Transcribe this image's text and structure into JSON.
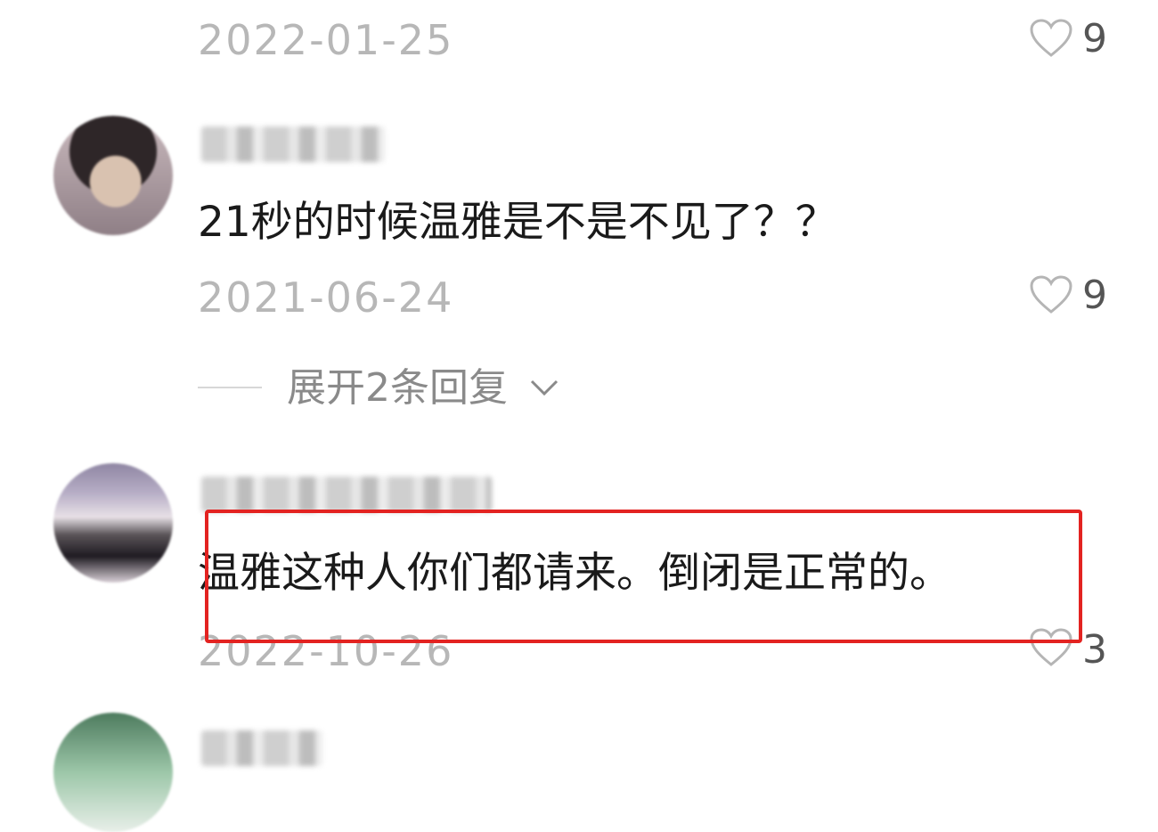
{
  "comments": [
    {
      "date": "2022-01-25",
      "likes": "9"
    },
    {
      "text": "21秒的时候温雅是不是不见了？？",
      "date": "2021-06-24",
      "likes": "9",
      "expand_label": "展开2条回复"
    },
    {
      "text": "温雅这种人你们都请来。倒闭是正常的。",
      "date": "2022-10-26",
      "likes": "3"
    }
  ],
  "accent_color": "#e32321"
}
